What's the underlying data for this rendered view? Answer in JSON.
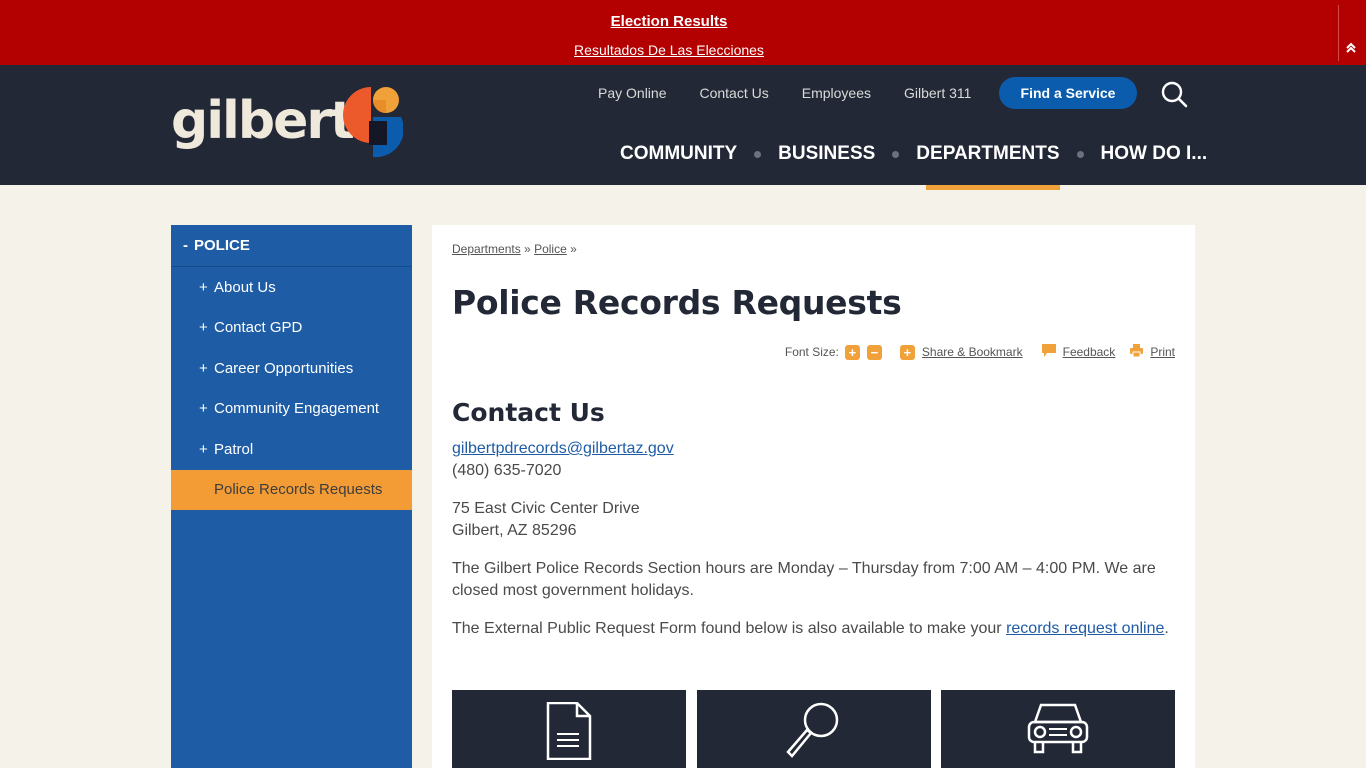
{
  "alert": {
    "title": "Election Results",
    "subtitle": "Resultados De Las Elecciones",
    "toggle_icon": "double-chevron-up-icon"
  },
  "header": {
    "logo_text": "gilbert",
    "utility_nav": [
      "Pay Online",
      "Contact Us",
      "Employees",
      "Gilbert 311"
    ],
    "find_service": "Find a Service",
    "search_icon": "search-icon",
    "main_nav": [
      {
        "label": "COMMUNITY",
        "active": false
      },
      {
        "label": "BUSINESS",
        "active": false
      },
      {
        "label": "DEPARTMENTS",
        "active": true
      },
      {
        "label": "HOW DO I...",
        "active": false
      }
    ]
  },
  "sidebar": {
    "heading": "POLICE",
    "heading_prefix": "-",
    "items": [
      {
        "label": "About Us",
        "prefix": "+"
      },
      {
        "label": "Contact GPD",
        "prefix": "+"
      },
      {
        "label": "Career Opportunities",
        "prefix": "+"
      },
      {
        "label": "Community Engagement",
        "prefix": "+"
      },
      {
        "label": "Patrol",
        "prefix": "+"
      },
      {
        "label": "Police Records Requests",
        "prefix": "",
        "current": true
      }
    ]
  },
  "content": {
    "breadcrumb": [
      {
        "label": "Departments"
      },
      {
        "label": "Police"
      }
    ],
    "breadcrumb_sep": "»",
    "title": "Police Records Requests",
    "tools": {
      "font_size_label": "Font Size:",
      "increase": "+",
      "decrease": "−",
      "share": "Share & Bookmark",
      "feedback": "Feedback",
      "print": "Print"
    },
    "section_title": "Contact Us",
    "email": "gilbertpdrecords@gilbertaz.gov",
    "phone": "(480) 635-7020",
    "address_line1": "75 East Civic Center Drive",
    "address_line2": "Gilbert, AZ 85296",
    "hours": "The Gilbert Police Records Section hours are Monday – Thursday from 7:00 AM – 4:00 PM. We are closed most government holidays.",
    "form_text": "The External Public Request Form found below is also available to make your ",
    "form_link": "records request online",
    "form_end": ".",
    "tiles": [
      {
        "icon": "document-icon"
      },
      {
        "icon": "magnifier-icon"
      },
      {
        "icon": "car-icon"
      }
    ]
  },
  "colors": {
    "alert_red": "#b30000",
    "header_navy": "#232836",
    "accent_orange": "#f0a13a",
    "sidebar_blue": "#1e5ca6",
    "button_blue": "#0b5cad",
    "page_bg": "#f5f2ea"
  }
}
